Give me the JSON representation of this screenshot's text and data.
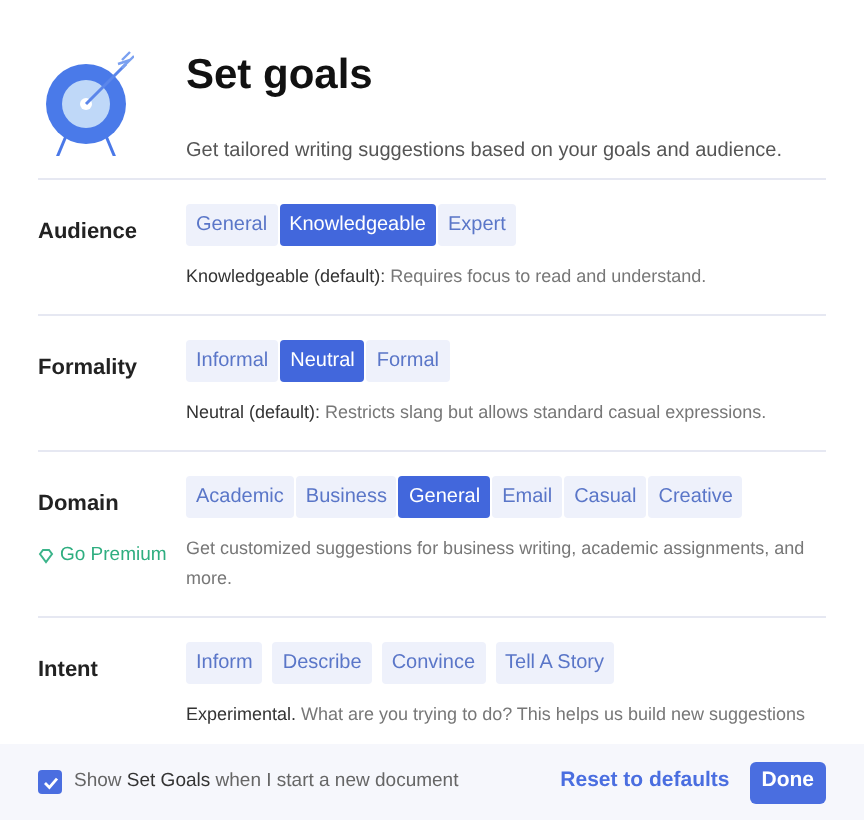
{
  "header": {
    "title": "Set goals",
    "subtitle": "Get tailored writing suggestions based on your goals and audience."
  },
  "sections": [
    {
      "label": "Audience",
      "kind": "joined",
      "options": [
        {
          "label": "General",
          "selected": false
        },
        {
          "label": "Knowledgeable",
          "selected": true
        },
        {
          "label": "Expert",
          "selected": false
        }
      ],
      "description": "**Knowledgeable (default):** Requires focus to read and understand."
    },
    {
      "label": "Formality",
      "kind": "joined",
      "options": [
        {
          "label": "Informal",
          "selected": false
        },
        {
          "label": "Neutral",
          "selected": true
        },
        {
          "label": "Formal",
          "selected": false
        }
      ],
      "description": "**Neutral (default):** Restricts slang but allows standard casual expressions."
    },
    {
      "label": "Domain",
      "kind": "joined",
      "premium": "Go Premium",
      "options": [
        {
          "label": "Academic",
          "selected": false
        },
        {
          "label": "Business",
          "selected": false
        },
        {
          "label": "General",
          "selected": true
        },
        {
          "label": "Email",
          "selected": false
        },
        {
          "label": "Casual",
          "selected": false
        },
        {
          "label": "Creative",
          "selected": false
        }
      ],
      "description": "Get customized suggestions for business writing, academic assignments, and more."
    },
    {
      "label": "Intent",
      "kind": "separate",
      "options": [
        {
          "label": "Inform",
          "selected": false
        },
        {
          "label": "Describe",
          "selected": false
        },
        {
          "label": "Convince",
          "selected": false
        },
        {
          "label": "Tell A Story",
          "selected": false
        }
      ],
      "description": "**Experimental.** What are you trying to do? This helps us build new suggestions"
    }
  ],
  "footer": {
    "checkbox": {
      "pre": "Show",
      "bold": "Set Goals",
      "post": "when I start a new document",
      "checked": true
    },
    "reset": "Reset to defaults",
    "done": "Done"
  }
}
